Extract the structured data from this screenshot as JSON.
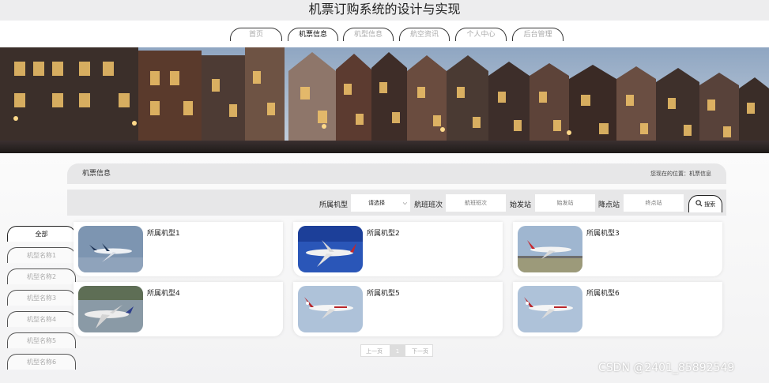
{
  "header": {
    "title": "机票订购系统的设计与实现"
  },
  "nav": {
    "items": [
      "首页",
      "机票信息",
      "机型信息",
      "航空资讯",
      "个人中心",
      "后台管理"
    ]
  },
  "breadcrumb": {
    "title": "机票信息",
    "location": "您现在的位置：机票信息"
  },
  "filter": {
    "model_label": "所属机型",
    "model_select": "请选择",
    "flight_label": "航班班次",
    "flight_placeholder": "航班班次",
    "origin_label": "始发站",
    "origin_placeholder": "始发站",
    "dest_label": "降点站",
    "dest_placeholder": "终点站",
    "search_label": "搜索"
  },
  "sidebar": {
    "items": [
      "全部",
      "机型名称1",
      "机型名称2",
      "机型名称3",
      "机型名称4",
      "机型名称5",
      "机型名称6"
    ]
  },
  "cards": [
    {
      "label": "所属机型1"
    },
    {
      "label": "所属机型2"
    },
    {
      "label": "所属机型3"
    },
    {
      "label": "所属机型4"
    },
    {
      "label": "所属机型5"
    },
    {
      "label": "所属机型6"
    }
  ],
  "pagination": {
    "prev": "上一页",
    "current": "1",
    "next": "下一页"
  },
  "watermark": "CSDN @2401_85892549"
}
